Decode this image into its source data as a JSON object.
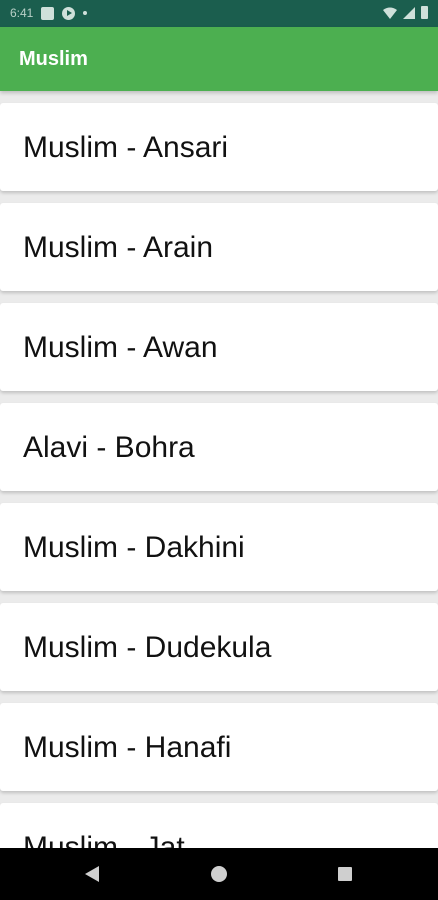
{
  "status_bar": {
    "time": "6:41",
    "icons": [
      "signal-icon",
      "stop-icon",
      "media-play-icon",
      "dot-icon",
      "wifi-icon",
      "cell-signal-icon",
      "battery-icon"
    ]
  },
  "app_bar": {
    "title": "Muslim"
  },
  "list": {
    "items": [
      {
        "label": "Muslim - Ansari"
      },
      {
        "label": "Muslim - Arain"
      },
      {
        "label": "Muslim - Awan"
      },
      {
        "label": "Alavi - Bohra"
      },
      {
        "label": "Muslim - Dakhini"
      },
      {
        "label": "Muslim - Dudekula"
      },
      {
        "label": "Muslim - Hanafi"
      },
      {
        "label": "Muslim - Jat"
      }
    ]
  },
  "nav_bar": {
    "icons": [
      "back-icon",
      "home-icon",
      "recents-icon"
    ]
  },
  "colors": {
    "status_bar": "#1b5e4e",
    "app_bar": "#4caf50",
    "background": "#ebebeb",
    "card": "#ffffff",
    "nav_bar": "#000000"
  }
}
